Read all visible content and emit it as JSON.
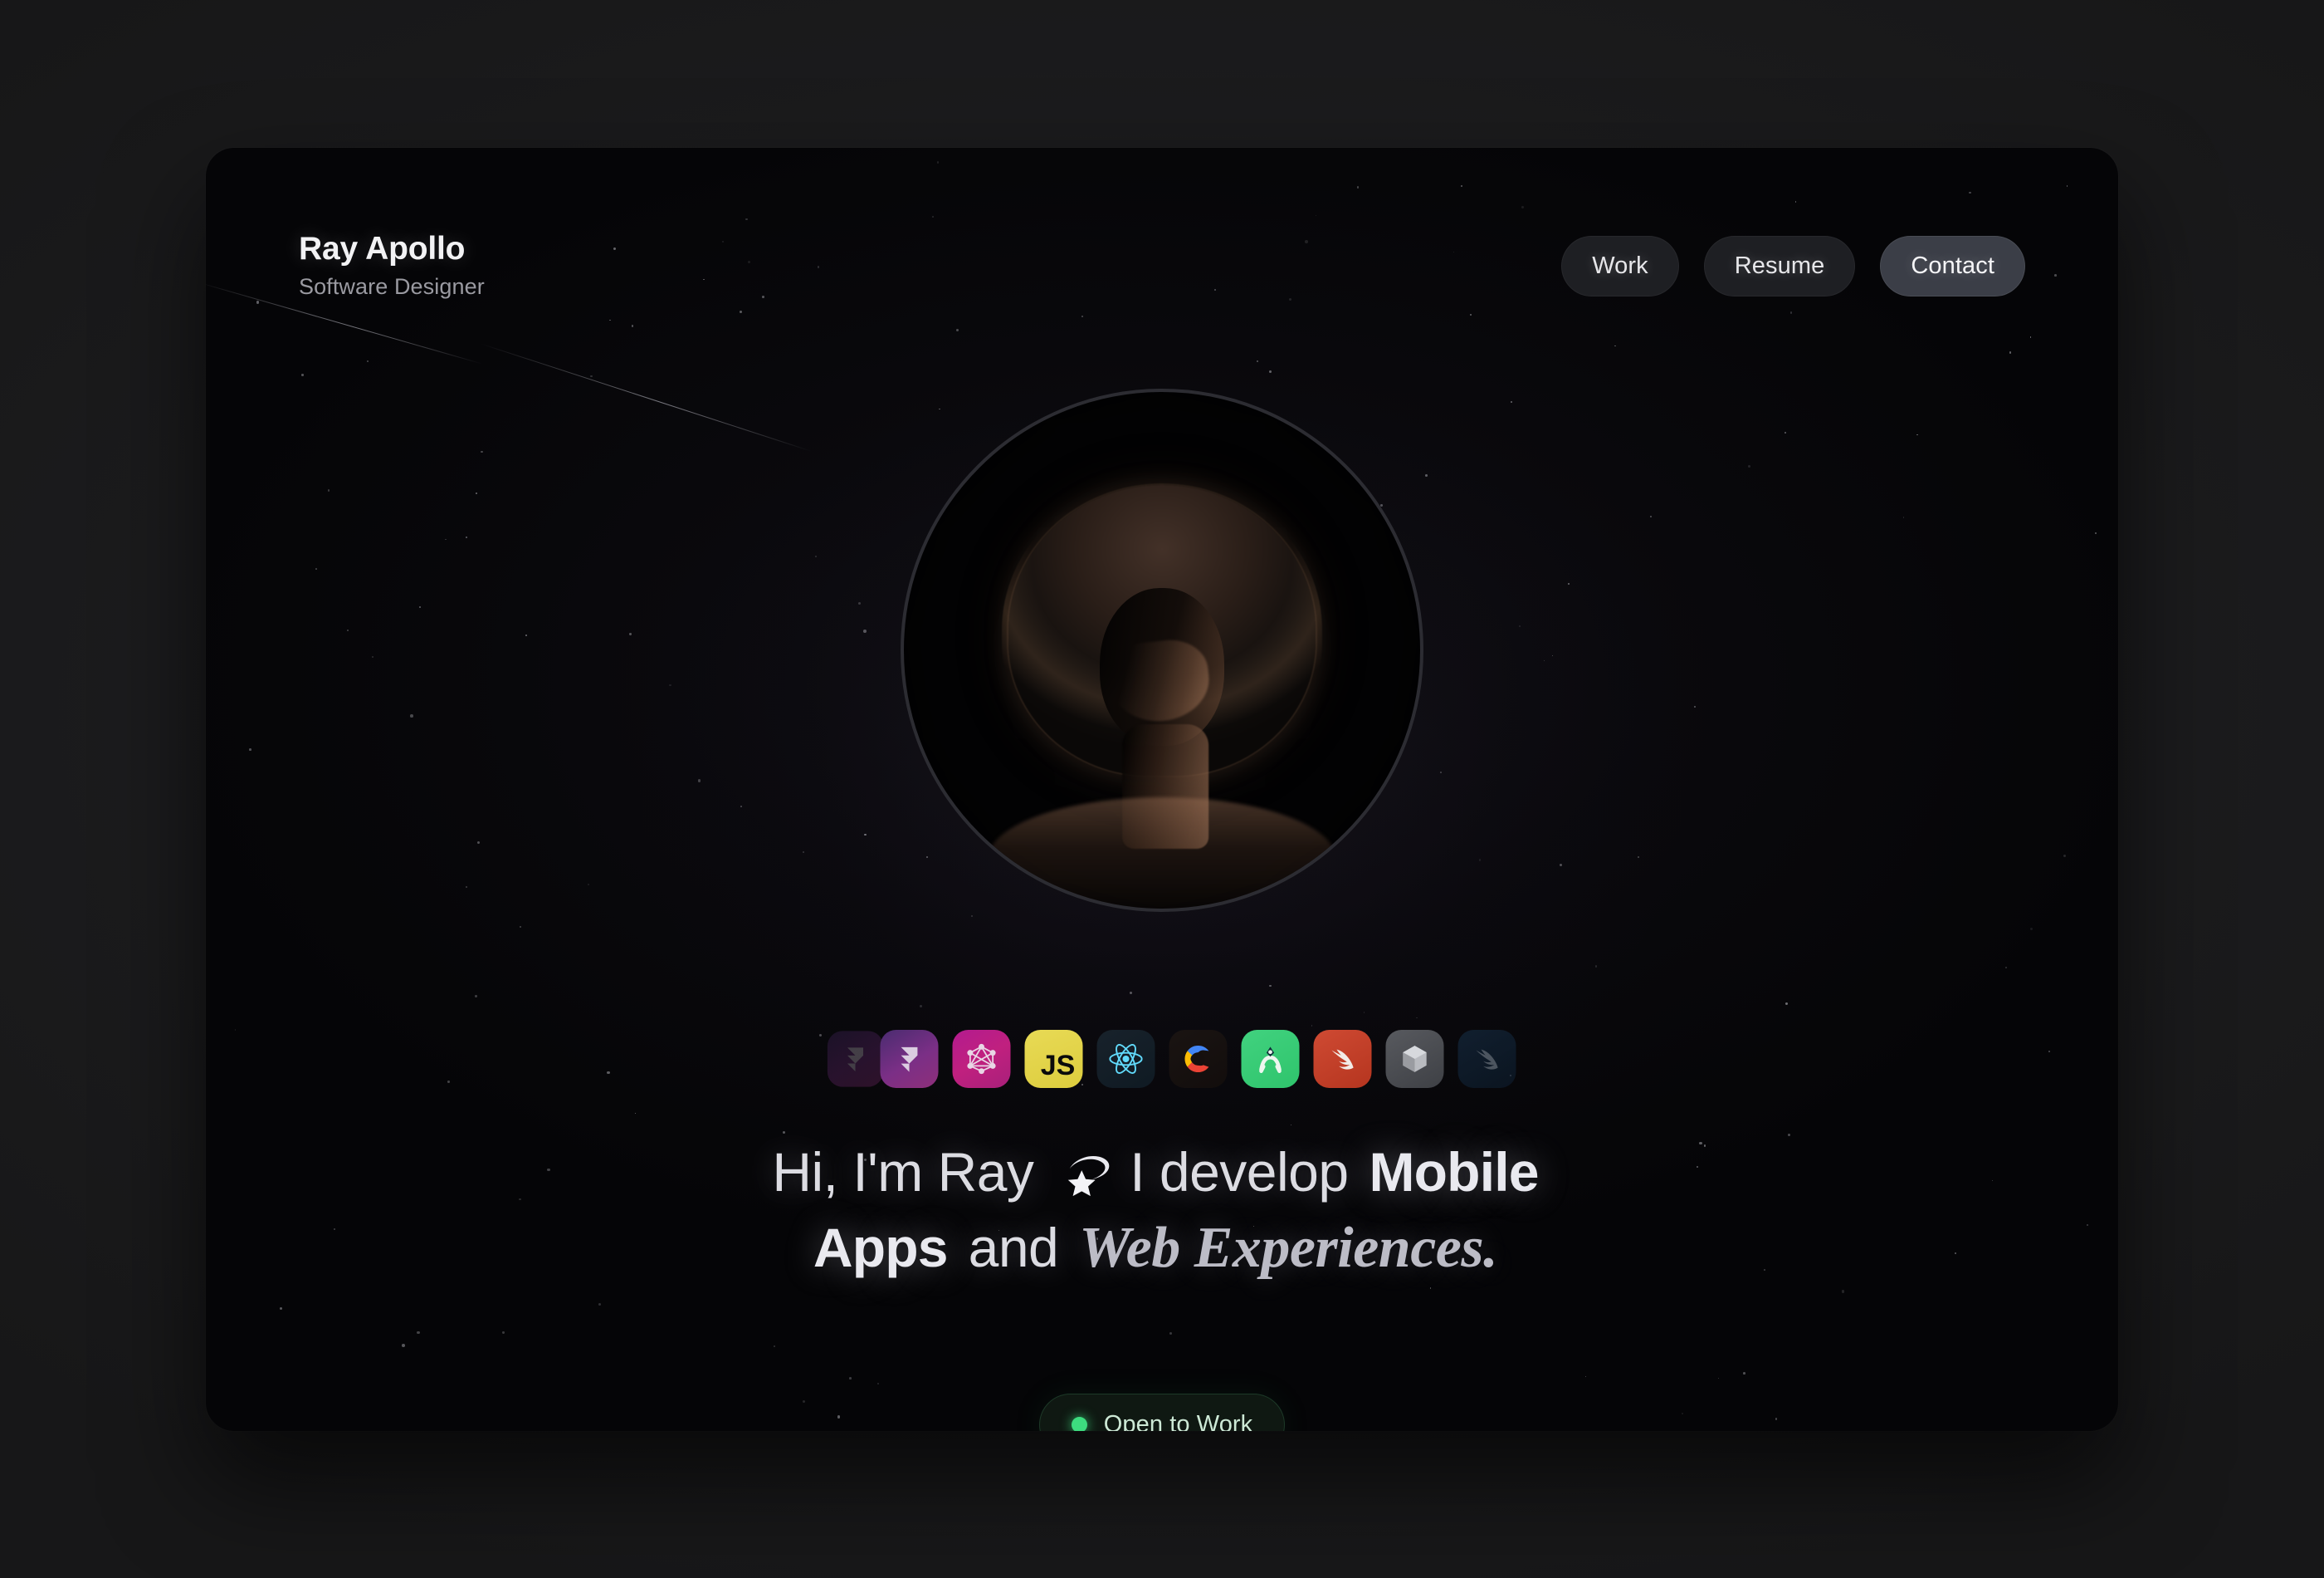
{
  "brand": {
    "name": "Ray Apollo",
    "role": "Software Designer"
  },
  "nav": {
    "items": [
      {
        "label": "Work",
        "active": false
      },
      {
        "label": "Resume",
        "active": false
      },
      {
        "label": "Contact",
        "active": true
      }
    ]
  },
  "portrait": {
    "alt": "Silhouette portrait of a person with an afro, rim lit"
  },
  "tech_stack": {
    "items": [
      {
        "name": "framer-icon",
        "label": "Framer",
        "color": "#7b2f86",
        "state": "faded-left"
      },
      {
        "name": "framer-icon",
        "label": "Framer",
        "color": "#7b2f86",
        "state": "normal"
      },
      {
        "name": "graphql-icon",
        "label": "GraphQL",
        "color": "#c0207f",
        "state": "normal"
      },
      {
        "name": "javascript-icon",
        "label": "JavaScript",
        "color": "#e8da55",
        "state": "normal"
      },
      {
        "name": "react-icon",
        "label": "React",
        "color": "#61dafb",
        "state": "normal"
      },
      {
        "name": "chrome-c-icon",
        "label": "C",
        "color": "#f4b400",
        "state": "normal"
      },
      {
        "name": "android-studio-icon",
        "label": "Android Studio",
        "color": "#3ddc84",
        "state": "normal"
      },
      {
        "name": "swift-icon",
        "label": "Swift",
        "color": "#cf4a33",
        "state": "normal"
      },
      {
        "name": "cube-3d-icon",
        "label": "3D Cube",
        "color": "#9a9ca1",
        "state": "normal"
      },
      {
        "name": "swiftui-icon",
        "label": "SwiftUI",
        "color": "#1c3c5a",
        "state": "faded-right"
      }
    ]
  },
  "headline": {
    "line1_part1": "Hi, I'm Ray",
    "comet_icon": "orbiting-star-icon",
    "line1_part2": "I develop",
    "line1_emphasis": "Mobile",
    "line2_emphasis": "Apps",
    "line2_conjunction": "and",
    "line2_serif": "Web Experiences."
  },
  "status": {
    "label": "Open to Work",
    "dot_color": "#3ddc7f",
    "text_color": "#cde9d6"
  },
  "theme": {
    "page_background": "#1b1b1d",
    "card_background": "#0a090d",
    "nav_button_background": "#1e1f23",
    "nav_button_active_background": "#3b3e47",
    "text_primary": "#f2f2f4",
    "text_secondary": "#9a9aa1"
  }
}
